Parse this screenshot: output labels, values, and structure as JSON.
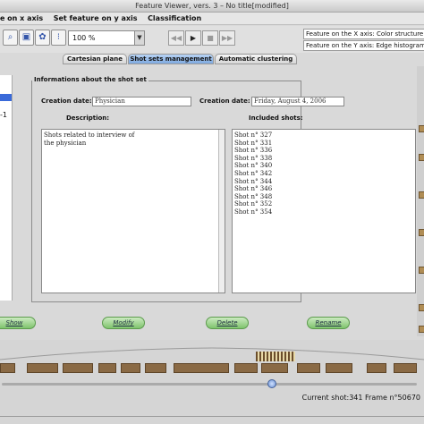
{
  "window": {
    "title": "Feature Viewer, vers. 3 – No title[modified]"
  },
  "menu": {
    "items": [
      "re on x axis",
      "Set feature on y axis",
      "Classification"
    ]
  },
  "toolbar": {
    "zoom_value": "100 %",
    "media": {
      "rewind": "◀◀",
      "play": "▶",
      "stop": "■",
      "forward": "▶▶"
    }
  },
  "features": {
    "x_axis": "Feature on the X axis: Color structure",
    "y_axis": "Feature on the Y axis: Edge histogram"
  },
  "left_panel": {
    "item_label": "-1"
  },
  "tabs": [
    "Cartesian plane",
    "Shot sets management",
    "Automatic clustering"
  ],
  "shot_set": {
    "group_title": "Informations about the shot set",
    "creation_label": "Creation date:",
    "name_value": "Physician",
    "creation_label_2": "Creation date:",
    "date_value": "Friday, August 4, 2006",
    "description_label": "Description:",
    "description_lines": [
      "Shots related to interview of",
      "the physician"
    ],
    "included_label": "Included shots:",
    "shots": [
      "Shot n° 327",
      "Shot n° 331",
      "Shot n° 336",
      "Shot n° 338",
      "Shot n° 340",
      "Shot n° 342",
      "Shot n° 344",
      "Shot n° 346",
      "Shot n° 348",
      "Shot n° 352",
      "Shot n° 354"
    ]
  },
  "actions": {
    "show": "Show",
    "modify": "Modify",
    "delete": "Delete",
    "rename": "Rename"
  },
  "status": {
    "text": "Current shot:341 Frame n°50670"
  },
  "colors": {
    "active_tab": "#7fa9e0",
    "action_button": "#7fc46d",
    "segment": "#8a6a45"
  }
}
